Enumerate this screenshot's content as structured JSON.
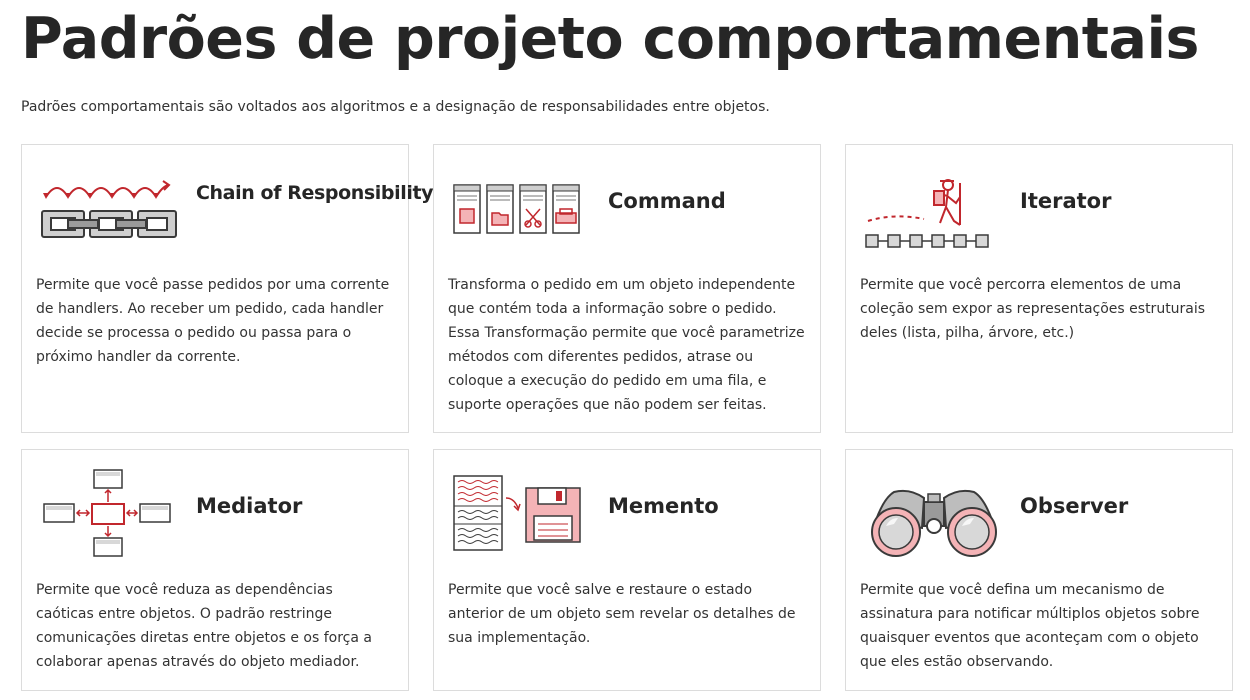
{
  "page": {
    "title": "Padrões de projeto comportamentais",
    "intro": "Padrões comportamentais são voltados aos algoritmos e a designação de responsabilidades entre objetos."
  },
  "patterns": [
    {
      "title": "Chain of Responsibility",
      "icon": "chain-of-responsibility-icon",
      "description": "Permite que você passe pedidos por uma corrente de handlers. Ao receber um pedido, cada handler decide se processa o pedido ou passa para o próximo handler da corrente."
    },
    {
      "title": "Command",
      "icon": "command-icon",
      "description": "Transforma o pedido em um objeto independente que contém toda a informação sobre o pedido. Essa Transformação permite que você parametrize métodos com diferentes pedidos, atrase ou coloque a execução do pedido em uma fila, e suporte operações que não podem ser feitas."
    },
    {
      "title": "Iterator",
      "icon": "iterator-icon",
      "description": "Permite que você percorra elementos de uma coleção sem expor as representações estruturais deles (lista, pilha, árvore, etc.)"
    },
    {
      "title": "Mediator",
      "icon": "mediator-icon",
      "description": "Permite que você reduza as dependências caóticas entre objetos. O padrão restringe comunicações diretas entre objetos e os força a colaborar apenas através do objeto mediador."
    },
    {
      "title": "Memento",
      "icon": "memento-icon",
      "description": "Permite que você salve e restaure o estado anterior de um objeto sem revelar os detalhes de sua implementação."
    },
    {
      "title": "Observer",
      "icon": "observer-icon",
      "description": "Permite que você defina um mecanismo de assinatura para notificar múltiplos objetos sobre quaisquer eventos que aconteçam com o objeto que eles estão observando."
    }
  ],
  "colors": {
    "accent": "#c1272d",
    "accent_light": "#f4b3b6",
    "stroke": "#3a3a3a",
    "fill": "#d8d8d8",
    "border": "#dcdcdc"
  }
}
